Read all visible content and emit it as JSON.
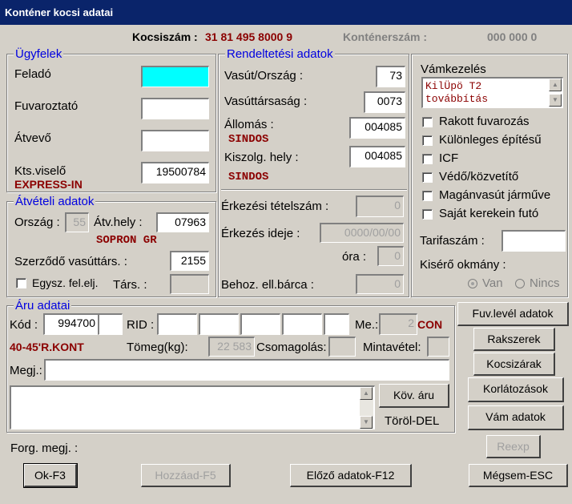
{
  "window": {
    "title": "Konténer kocsi adatai"
  },
  "header": {
    "kocsiszam_label": "Kocsiszám :",
    "kocsiszam_value": "31 81 495 8000 9",
    "kontenerszam_label": "Konténerszám :",
    "kontenerszam_value": "000 000 0"
  },
  "ugyfelek": {
    "title": "Ügyfelek",
    "felado_label": "Feladó",
    "felado_value": "",
    "fuvaroztato_label": "Fuvaroztató",
    "fuvaroztato_value": "",
    "atvevo_label": "Átvevő",
    "atvevo_value": "",
    "ktsviselo_label": "Kts.viselő",
    "ktsviselo_value": "19500784",
    "ktsviselo_name": "EXPRESS-IN"
  },
  "atveteli": {
    "title": "Átvételi adatok",
    "orszag_label": "Ország :",
    "orszag_value": "55",
    "atvhely_label": "Átv.hely :",
    "atvhely_value": "07963",
    "atvhely_name": "SOPRON GR",
    "szerzodo_label": "Szerződő vasúttárs. :",
    "szerzodo_value": "2155",
    "egysz_label": "Egysz. fel.elj.",
    "tars_label": "Társ. :",
    "tars_value": ""
  },
  "rendeltetesi": {
    "title": "Rendeltetési adatok",
    "vasut_label": "Vasút/Ország :",
    "vasut_value": "73",
    "vasuttarsasag_label": "Vasúttársaság :",
    "vasuttarsasag_value": "0073",
    "allomas_label": "Állomás :",
    "allomas_value": "004085",
    "allomas_name": "SINDOS",
    "kiszolg_label": "Kiszolg. hely :",
    "kiszolg_value": "004085",
    "kiszolg_name": "SINDOS",
    "erkezesi_tetel_label": "Érkezési tételszám :",
    "erkezesi_tetel_value": "0",
    "erkezes_ideje_label": "Érkezés ideje :",
    "erkezes_ideje_value": "0000/00/00",
    "ora_label": "óra :",
    "ora_value": "0",
    "behoz_label": "Behoz. ell.bárca :",
    "behoz_value": "0"
  },
  "right": {
    "vamkezeles_label": "Vámkezelés",
    "vamkezeles_line1": "KilÜpö T2",
    "vamkezeles_line2": "továbbítás",
    "checkboxes": [
      "Rakott fuvarozás",
      "Különleges építésű",
      "ICF",
      "Védő/közvetítő",
      "Magánvasút járműve",
      "Saját kerekein futó"
    ],
    "tarifaszam_label": "Tarifaszám :",
    "tarifaszam_value": "",
    "kisero_label": "Kisérő okmány :",
    "radio_van": "Van",
    "radio_nincs": "Nincs"
  },
  "aru": {
    "title": "Áru adatai",
    "kod_label": "Kód :",
    "kod_value": "994700",
    "kod_value2": "",
    "rid_label": "RID :",
    "me_label": "Me.:",
    "me_value": "2",
    "me_unit": "CON",
    "aru_name": "40-45'R.KONT",
    "tomeg_label": "Tömeg(kg):",
    "tomeg_value": "22 583",
    "csomagolas_label": "Csomagolás:",
    "mintavetel_label": "Mintavétel:",
    "megj_label": "Megj.:",
    "megj_value": "",
    "kov_aru": "Köv. áru",
    "torol": "Töröl-DEL"
  },
  "side_buttons": {
    "fuvlevel": "Fuv.levél adatok",
    "rakszerek": "Rakszerek",
    "kocsizarak": "Kocsizárak",
    "korlatozasok": "Korlátozások",
    "vam": "Vám adatok",
    "reexp": "Reexp"
  },
  "footer": {
    "forg_label": "Forg. megj. :",
    "ok": "Ok-F3",
    "hozzaad": "Hozzáad-F5",
    "elozo": "Előző adatok-F12",
    "megsem": "Mégsem-ESC"
  }
}
